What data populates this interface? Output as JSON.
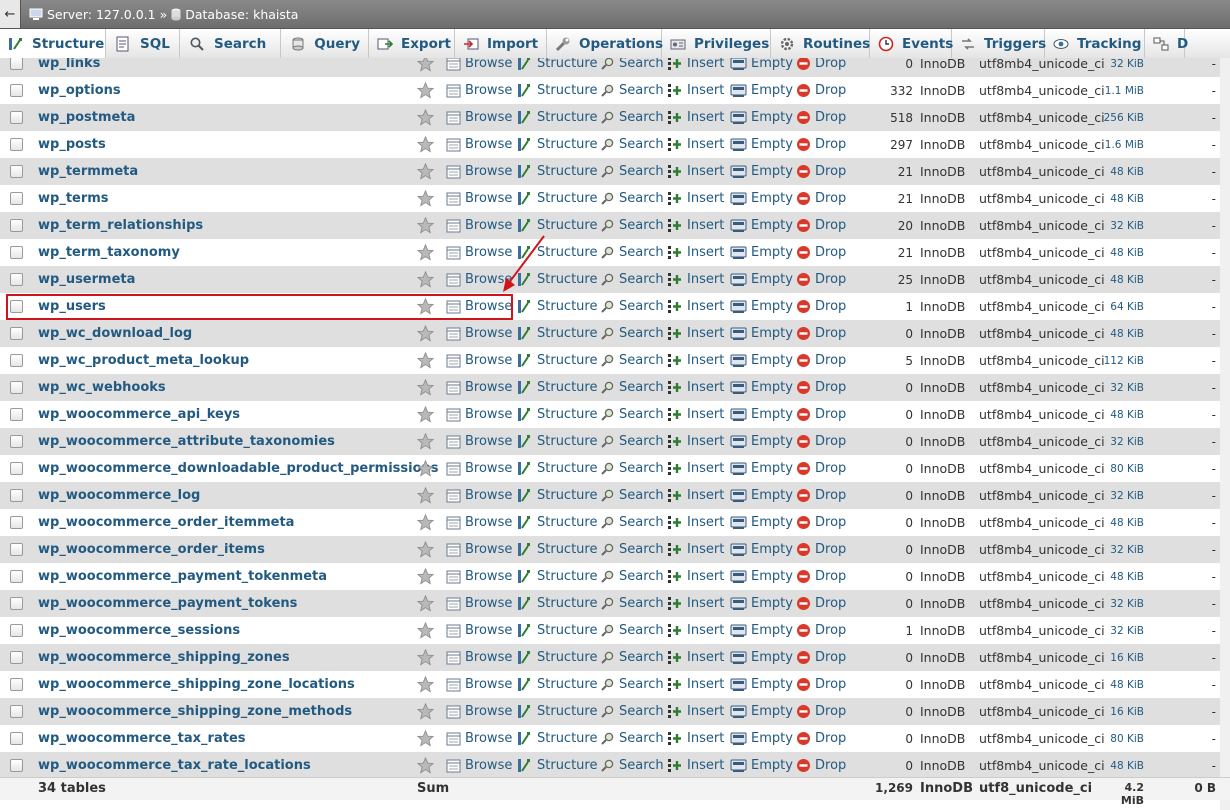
{
  "breadcrumb": {
    "back": "←",
    "server": "Server: 127.0.0.1",
    "separator": "»",
    "database": "Database: khaista"
  },
  "tabs": [
    {
      "label": "Structure",
      "icon": "structure-icon",
      "active": true
    },
    {
      "label": "SQL",
      "icon": "sql-icon"
    },
    {
      "label": "Search",
      "icon": "search-icon"
    },
    {
      "label": "Query",
      "icon": "query-icon"
    },
    {
      "label": "Export",
      "icon": "export-icon"
    },
    {
      "label": "Import",
      "icon": "import-icon"
    },
    {
      "label": "Operations",
      "icon": "wrench-icon"
    },
    {
      "label": "Privileges",
      "icon": "privileges-icon"
    },
    {
      "label": "Routines",
      "icon": "routines-icon"
    },
    {
      "label": "Events",
      "icon": "clock-icon"
    },
    {
      "label": "Triggers",
      "icon": "triggers-icon"
    },
    {
      "label": "Tracking",
      "icon": "eye-icon"
    },
    {
      "label": "D",
      "icon": "designer-icon"
    }
  ],
  "actions": {
    "browse": "Browse",
    "structure": "Structure",
    "search": "Search",
    "insert": "Insert",
    "empty": "Empty",
    "drop": "Drop"
  },
  "tables": [
    {
      "name": "wp_links",
      "rows": "0",
      "engine": "InnoDB",
      "collation": "utf8mb4_unicode_ci",
      "size": "32 KiB",
      "overhead": "-"
    },
    {
      "name": "wp_options",
      "rows": "332",
      "engine": "InnoDB",
      "collation": "utf8mb4_unicode_ci",
      "size": "1.1 MiB",
      "overhead": "-"
    },
    {
      "name": "wp_postmeta",
      "rows": "518",
      "engine": "InnoDB",
      "collation": "utf8mb4_unicode_ci",
      "size": "256 KiB",
      "overhead": "-"
    },
    {
      "name": "wp_posts",
      "rows": "297",
      "engine": "InnoDB",
      "collation": "utf8mb4_unicode_ci",
      "size": "1.6 MiB",
      "overhead": "-"
    },
    {
      "name": "wp_termmeta",
      "rows": "21",
      "engine": "InnoDB",
      "collation": "utf8mb4_unicode_ci",
      "size": "48 KiB",
      "overhead": "-"
    },
    {
      "name": "wp_terms",
      "rows": "21",
      "engine": "InnoDB",
      "collation": "utf8mb4_unicode_ci",
      "size": "48 KiB",
      "overhead": "-"
    },
    {
      "name": "wp_term_relationships",
      "rows": "20",
      "engine": "InnoDB",
      "collation": "utf8mb4_unicode_ci",
      "size": "32 KiB",
      "overhead": "-"
    },
    {
      "name": "wp_term_taxonomy",
      "rows": "21",
      "engine": "InnoDB",
      "collation": "utf8mb4_unicode_ci",
      "size": "48 KiB",
      "overhead": "-"
    },
    {
      "name": "wp_usermeta",
      "rows": "25",
      "engine": "InnoDB",
      "collation": "utf8mb4_unicode_ci",
      "size": "48 KiB",
      "overhead": "-"
    },
    {
      "name": "wp_users",
      "rows": "1",
      "engine": "InnoDB",
      "collation": "utf8mb4_unicode_ci",
      "size": "64 KiB",
      "overhead": "-"
    },
    {
      "name": "wp_wc_download_log",
      "rows": "0",
      "engine": "InnoDB",
      "collation": "utf8mb4_unicode_ci",
      "size": "48 KiB",
      "overhead": "-"
    },
    {
      "name": "wp_wc_product_meta_lookup",
      "rows": "5",
      "engine": "InnoDB",
      "collation": "utf8mb4_unicode_ci",
      "size": "112 KiB",
      "overhead": "-"
    },
    {
      "name": "wp_wc_webhooks",
      "rows": "0",
      "engine": "InnoDB",
      "collation": "utf8mb4_unicode_ci",
      "size": "32 KiB",
      "overhead": "-"
    },
    {
      "name": "wp_woocommerce_api_keys",
      "rows": "0",
      "engine": "InnoDB",
      "collation": "utf8mb4_unicode_ci",
      "size": "48 KiB",
      "overhead": "-"
    },
    {
      "name": "wp_woocommerce_attribute_taxonomies",
      "rows": "0",
      "engine": "InnoDB",
      "collation": "utf8mb4_unicode_ci",
      "size": "32 KiB",
      "overhead": "-"
    },
    {
      "name": "wp_woocommerce_downloadable_product_permissions",
      "rows": "0",
      "engine": "InnoDB",
      "collation": "utf8mb4_unicode_ci",
      "size": "80 KiB",
      "overhead": "-"
    },
    {
      "name": "wp_woocommerce_log",
      "rows": "0",
      "engine": "InnoDB",
      "collation": "utf8mb4_unicode_ci",
      "size": "32 KiB",
      "overhead": "-"
    },
    {
      "name": "wp_woocommerce_order_itemmeta",
      "rows": "0",
      "engine": "InnoDB",
      "collation": "utf8mb4_unicode_ci",
      "size": "48 KiB",
      "overhead": "-"
    },
    {
      "name": "wp_woocommerce_order_items",
      "rows": "0",
      "engine": "InnoDB",
      "collation": "utf8mb4_unicode_ci",
      "size": "32 KiB",
      "overhead": "-"
    },
    {
      "name": "wp_woocommerce_payment_tokenmeta",
      "rows": "0",
      "engine": "InnoDB",
      "collation": "utf8mb4_unicode_ci",
      "size": "48 KiB",
      "overhead": "-"
    },
    {
      "name": "wp_woocommerce_payment_tokens",
      "rows": "0",
      "engine": "InnoDB",
      "collation": "utf8mb4_unicode_ci",
      "size": "32 KiB",
      "overhead": "-"
    },
    {
      "name": "wp_woocommerce_sessions",
      "rows": "1",
      "engine": "InnoDB",
      "collation": "utf8mb4_unicode_ci",
      "size": "32 KiB",
      "overhead": "-"
    },
    {
      "name": "wp_woocommerce_shipping_zones",
      "rows": "0",
      "engine": "InnoDB",
      "collation": "utf8mb4_unicode_ci",
      "size": "16 KiB",
      "overhead": "-"
    },
    {
      "name": "wp_woocommerce_shipping_zone_locations",
      "rows": "0",
      "engine": "InnoDB",
      "collation": "utf8mb4_unicode_ci",
      "size": "48 KiB",
      "overhead": "-"
    },
    {
      "name": "wp_woocommerce_shipping_zone_methods",
      "rows": "0",
      "engine": "InnoDB",
      "collation": "utf8mb4_unicode_ci",
      "size": "16 KiB",
      "overhead": "-"
    },
    {
      "name": "wp_woocommerce_tax_rates",
      "rows": "0",
      "engine": "InnoDB",
      "collation": "utf8mb4_unicode_ci",
      "size": "80 KiB",
      "overhead": "-"
    },
    {
      "name": "wp_woocommerce_tax_rate_locations",
      "rows": "0",
      "engine": "InnoDB",
      "collation": "utf8mb4_unicode_ci",
      "size": "48 KiB",
      "overhead": "-"
    }
  ],
  "footer": {
    "count": "34 tables",
    "sum_label": "Sum",
    "rows_total": "1,269",
    "engine": "InnoDB",
    "collation": "utf8_unicode_ci",
    "size_total": "4.2 MiB",
    "overhead_total": "0 B"
  },
  "colors": {
    "link": "#235a81",
    "highlight": "#d0141c",
    "drop": "#d9392b"
  }
}
